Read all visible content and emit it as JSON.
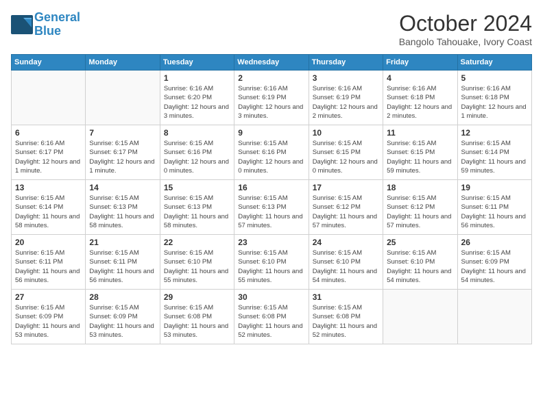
{
  "header": {
    "logo_line1": "General",
    "logo_line2": "Blue",
    "month_title": "October 2024",
    "location": "Bangolo Tahouake, Ivory Coast"
  },
  "weekdays": [
    "Sunday",
    "Monday",
    "Tuesday",
    "Wednesday",
    "Thursday",
    "Friday",
    "Saturday"
  ],
  "weeks": [
    [
      {
        "day": "",
        "info": ""
      },
      {
        "day": "",
        "info": ""
      },
      {
        "day": "1",
        "info": "Sunrise: 6:16 AM\nSunset: 6:20 PM\nDaylight: 12 hours and 3 minutes."
      },
      {
        "day": "2",
        "info": "Sunrise: 6:16 AM\nSunset: 6:19 PM\nDaylight: 12 hours and 3 minutes."
      },
      {
        "day": "3",
        "info": "Sunrise: 6:16 AM\nSunset: 6:19 PM\nDaylight: 12 hours and 2 minutes."
      },
      {
        "day": "4",
        "info": "Sunrise: 6:16 AM\nSunset: 6:18 PM\nDaylight: 12 hours and 2 minutes."
      },
      {
        "day": "5",
        "info": "Sunrise: 6:16 AM\nSunset: 6:18 PM\nDaylight: 12 hours and 1 minute."
      }
    ],
    [
      {
        "day": "6",
        "info": "Sunrise: 6:16 AM\nSunset: 6:17 PM\nDaylight: 12 hours and 1 minute."
      },
      {
        "day": "7",
        "info": "Sunrise: 6:15 AM\nSunset: 6:17 PM\nDaylight: 12 hours and 1 minute."
      },
      {
        "day": "8",
        "info": "Sunrise: 6:15 AM\nSunset: 6:16 PM\nDaylight: 12 hours and 0 minutes."
      },
      {
        "day": "9",
        "info": "Sunrise: 6:15 AM\nSunset: 6:16 PM\nDaylight: 12 hours and 0 minutes."
      },
      {
        "day": "10",
        "info": "Sunrise: 6:15 AM\nSunset: 6:15 PM\nDaylight: 12 hours and 0 minutes."
      },
      {
        "day": "11",
        "info": "Sunrise: 6:15 AM\nSunset: 6:15 PM\nDaylight: 11 hours and 59 minutes."
      },
      {
        "day": "12",
        "info": "Sunrise: 6:15 AM\nSunset: 6:14 PM\nDaylight: 11 hours and 59 minutes."
      }
    ],
    [
      {
        "day": "13",
        "info": "Sunrise: 6:15 AM\nSunset: 6:14 PM\nDaylight: 11 hours and 58 minutes."
      },
      {
        "day": "14",
        "info": "Sunrise: 6:15 AM\nSunset: 6:13 PM\nDaylight: 11 hours and 58 minutes."
      },
      {
        "day": "15",
        "info": "Sunrise: 6:15 AM\nSunset: 6:13 PM\nDaylight: 11 hours and 58 minutes."
      },
      {
        "day": "16",
        "info": "Sunrise: 6:15 AM\nSunset: 6:13 PM\nDaylight: 11 hours and 57 minutes."
      },
      {
        "day": "17",
        "info": "Sunrise: 6:15 AM\nSunset: 6:12 PM\nDaylight: 11 hours and 57 minutes."
      },
      {
        "day": "18",
        "info": "Sunrise: 6:15 AM\nSunset: 6:12 PM\nDaylight: 11 hours and 57 minutes."
      },
      {
        "day": "19",
        "info": "Sunrise: 6:15 AM\nSunset: 6:11 PM\nDaylight: 11 hours and 56 minutes."
      }
    ],
    [
      {
        "day": "20",
        "info": "Sunrise: 6:15 AM\nSunset: 6:11 PM\nDaylight: 11 hours and 56 minutes."
      },
      {
        "day": "21",
        "info": "Sunrise: 6:15 AM\nSunset: 6:11 PM\nDaylight: 11 hours and 56 minutes."
      },
      {
        "day": "22",
        "info": "Sunrise: 6:15 AM\nSunset: 6:10 PM\nDaylight: 11 hours and 55 minutes."
      },
      {
        "day": "23",
        "info": "Sunrise: 6:15 AM\nSunset: 6:10 PM\nDaylight: 11 hours and 55 minutes."
      },
      {
        "day": "24",
        "info": "Sunrise: 6:15 AM\nSunset: 6:10 PM\nDaylight: 11 hours and 54 minutes."
      },
      {
        "day": "25",
        "info": "Sunrise: 6:15 AM\nSunset: 6:10 PM\nDaylight: 11 hours and 54 minutes."
      },
      {
        "day": "26",
        "info": "Sunrise: 6:15 AM\nSunset: 6:09 PM\nDaylight: 11 hours and 54 minutes."
      }
    ],
    [
      {
        "day": "27",
        "info": "Sunrise: 6:15 AM\nSunset: 6:09 PM\nDaylight: 11 hours and 53 minutes."
      },
      {
        "day": "28",
        "info": "Sunrise: 6:15 AM\nSunset: 6:09 PM\nDaylight: 11 hours and 53 minutes."
      },
      {
        "day": "29",
        "info": "Sunrise: 6:15 AM\nSunset: 6:08 PM\nDaylight: 11 hours and 53 minutes."
      },
      {
        "day": "30",
        "info": "Sunrise: 6:15 AM\nSunset: 6:08 PM\nDaylight: 11 hours and 52 minutes."
      },
      {
        "day": "31",
        "info": "Sunrise: 6:15 AM\nSunset: 6:08 PM\nDaylight: 11 hours and 52 minutes."
      },
      {
        "day": "",
        "info": ""
      },
      {
        "day": "",
        "info": ""
      }
    ]
  ]
}
